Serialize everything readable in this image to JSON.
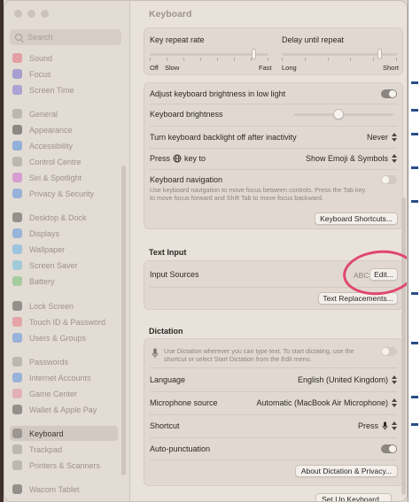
{
  "window": {
    "title": "Keyboard"
  },
  "sidebar": {
    "search_placeholder": "Search",
    "items": [
      {
        "label": "Sound",
        "icon": "speaker-icon",
        "color": "#e0546a"
      },
      {
        "label": "Focus",
        "icon": "moon-icon",
        "color": "#5b55c9"
      },
      {
        "label": "Screen Time",
        "icon": "hourglass-icon",
        "color": "#6a5bd4"
      },
      {
        "label": "General",
        "icon": "gear-icon",
        "color": "#8e8a87"
      },
      {
        "label": "Appearance",
        "icon": "appearance-icon",
        "color": "#222222"
      },
      {
        "label": "Accessibility",
        "icon": "accessibility-icon",
        "color": "#2f7be0"
      },
      {
        "label": "Control Centre",
        "icon": "control-centre-icon",
        "color": "#8e8a87"
      },
      {
        "label": "Siri & Spotlight",
        "icon": "siri-icon",
        "color": "#c64fcf"
      },
      {
        "label": "Privacy & Security",
        "icon": "hand-icon",
        "color": "#3f7fe0"
      },
      {
        "label": "Desktop & Dock",
        "icon": "dock-icon",
        "color": "#333333"
      },
      {
        "label": "Displays",
        "icon": "display-icon",
        "color": "#3e86e0"
      },
      {
        "label": "Wallpaper",
        "icon": "wallpaper-icon",
        "color": "#48a6e8"
      },
      {
        "label": "Screen Saver",
        "icon": "screensaver-icon",
        "color": "#4fb5e0"
      },
      {
        "label": "Battery",
        "icon": "battery-icon",
        "color": "#58b85c"
      },
      {
        "label": "Lock Screen",
        "icon": "lock-screen-icon",
        "color": "#333333"
      },
      {
        "label": "Touch ID & Password",
        "icon": "fingerprint-icon",
        "color": "#e65f70"
      },
      {
        "label": "Users & Groups",
        "icon": "users-icon",
        "color": "#3f7fe0"
      },
      {
        "label": "Passwords",
        "icon": "key-icon",
        "color": "#8e8a87"
      },
      {
        "label": "Internet Accounts",
        "icon": "at-icon",
        "color": "#3f7fe0"
      },
      {
        "label": "Game Center",
        "icon": "game-center-icon",
        "color": "#e07a9a"
      },
      {
        "label": "Wallet & Apple Pay",
        "icon": "wallet-icon",
        "color": "#333333"
      },
      {
        "label": "Keyboard",
        "icon": "keyboard-icon",
        "color": "#8e8a87"
      },
      {
        "label": "Trackpad",
        "icon": "trackpad-icon",
        "color": "#8e8a87"
      },
      {
        "label": "Printers & Scanners",
        "icon": "printer-icon",
        "color": "#8e8a87"
      },
      {
        "label": "Wacom Tablet",
        "icon": "tablet-icon",
        "color": "#333333"
      }
    ]
  },
  "repeat": {
    "key_repeat_label": "Key repeat rate",
    "delay_label": "Delay until repeat",
    "off": "Off",
    "slow": "Slow",
    "fast": "Fast",
    "long": "Long",
    "short": "Short",
    "key_repeat_level": 0.88,
    "delay_level": 0.85
  },
  "settings": {
    "adjust_brightness": "Adjust keyboard brightness in low light",
    "adjust_brightness_on": true,
    "brightness_label": "Keyboard brightness",
    "brightness_level": 0.45,
    "backlight_off": "Turn keyboard backlight off after inactivity",
    "backlight_off_value": "Never",
    "press_key_prefix": "Press",
    "press_key_suffix": "key to",
    "press_key_value": "Show Emoji & Symbols",
    "nav_label": "Keyboard navigation",
    "nav_desc": "Use keyboard navigation to move focus between controls. Press the Tab key to move focus forward and Shift Tab to move focus backward.",
    "nav_on": false,
    "shortcuts_button": "Keyboard Shortcuts..."
  },
  "text_input": {
    "heading": "Text Input",
    "sources_label": "Input Sources",
    "sources_value": "ABC",
    "edit_button": "Edit...",
    "replacements_button": "Text Replacements..."
  },
  "dictation": {
    "heading": "Dictation",
    "desc": "Use Dictation wherever you can type text. To start dictating, use the shortcut or select Start Dictation from the Edit menu.",
    "enabled": false,
    "language_label": "Language",
    "language_value": "English (United Kingdom)",
    "mic_label": "Microphone source",
    "mic_value": "Automatic (MacBook Air Microphone)",
    "shortcut_label": "Shortcut",
    "shortcut_value": "Press",
    "autopunct_label": "Auto-punctuation",
    "autopunct_on": true,
    "about_button": "About Dictation & Privacy...",
    "setup_button": "Set Up Keyboard..."
  }
}
